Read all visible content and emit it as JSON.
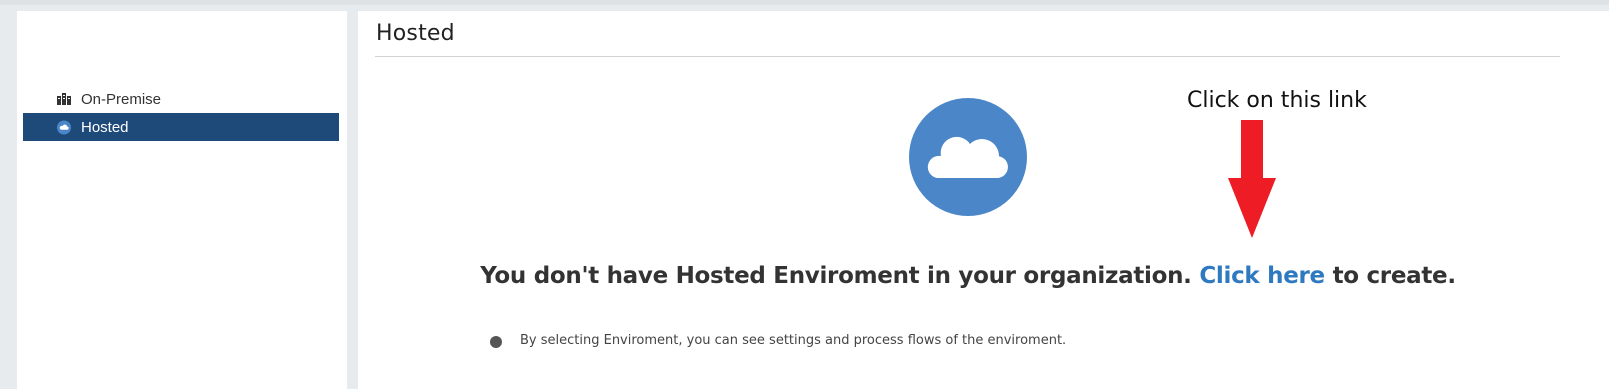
{
  "sidebar": {
    "items": [
      {
        "label": "On-Premise",
        "icon": "building-icon",
        "active": false
      },
      {
        "label": "Hosted",
        "icon": "cloud-icon",
        "active": true
      }
    ]
  },
  "main": {
    "title": "Hosted",
    "empty_state": {
      "icon": "cloud-icon",
      "message_prefix": "You don't have Hosted Enviroment in your organization.",
      "link_label": "Click here",
      "message_suffix": "to create."
    },
    "hint": "By selecting Enviroment, you can see settings and process flows of the enviroment."
  },
  "annotation": {
    "text": "Click on this link",
    "arrow_color": "#ee1c25"
  },
  "colors": {
    "sidebar_active": "#1e4a7a",
    "cloud_circle": "#4a86c8",
    "link": "#2f79c0"
  }
}
